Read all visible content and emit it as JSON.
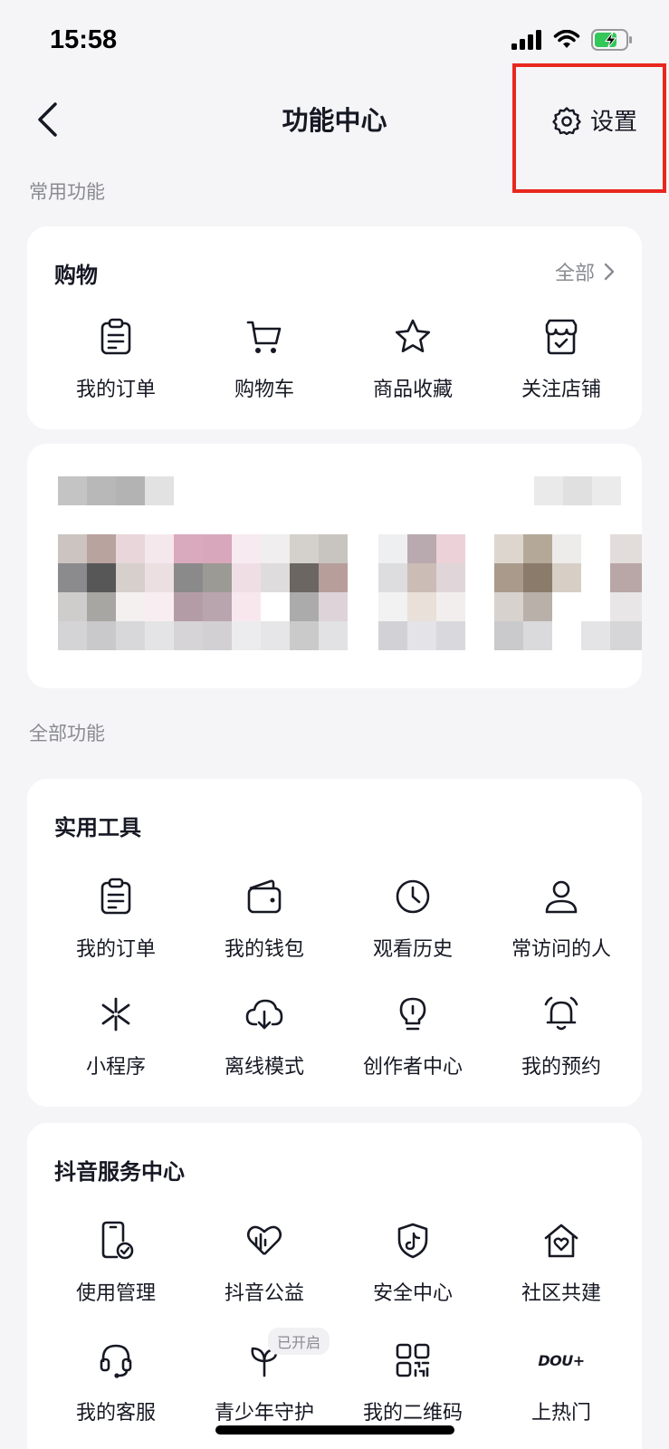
{
  "status": {
    "time": "15:58"
  },
  "nav": {
    "title": "功能中心",
    "settings_label": "设置"
  },
  "sections": {
    "common": "常用功能",
    "all": "全部功能"
  },
  "shopping": {
    "title": "购物",
    "more_label": "全部",
    "items": [
      {
        "label": "我的订单",
        "icon": "order-icon"
      },
      {
        "label": "购物车",
        "icon": "cart-icon"
      },
      {
        "label": "商品收藏",
        "icon": "star-icon"
      },
      {
        "label": "关注店铺",
        "icon": "store-icon"
      }
    ]
  },
  "tools": {
    "title": "实用工具",
    "items": [
      {
        "label": "我的订单",
        "icon": "order-icon"
      },
      {
        "label": "我的钱包",
        "icon": "wallet-icon"
      },
      {
        "label": "观看历史",
        "icon": "clock-icon"
      },
      {
        "label": "常访问的人",
        "icon": "person-icon"
      },
      {
        "label": "小程序",
        "icon": "mini-program-icon"
      },
      {
        "label": "离线模式",
        "icon": "cloud-download-icon"
      },
      {
        "label": "创作者中心",
        "icon": "bulb-icon"
      },
      {
        "label": "我的预约",
        "icon": "bell-icon"
      }
    ]
  },
  "service": {
    "title": "抖音服务中心",
    "badge": "已开启",
    "items": [
      {
        "label": "使用管理",
        "icon": "phone-check-icon"
      },
      {
        "label": "抖音公益",
        "icon": "heart-chart-icon"
      },
      {
        "label": "安全中心",
        "icon": "shield-icon"
      },
      {
        "label": "社区共建",
        "icon": "house-heart-icon"
      },
      {
        "label": "我的客服",
        "icon": "headset-icon"
      },
      {
        "label": "青少年守护",
        "icon": "sprout-icon"
      },
      {
        "label": "我的二维码",
        "icon": "qrcode-icon"
      },
      {
        "label": "上热门",
        "icon": "dou-plus-icon",
        "icon_text": "DOU+"
      }
    ]
  },
  "colors": {
    "accent_box": "#e8271f",
    "battery": "#34c759"
  }
}
